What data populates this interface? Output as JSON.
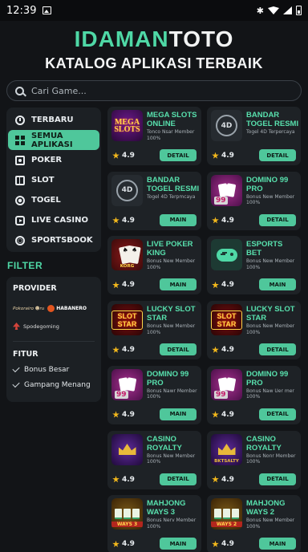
{
  "status_bar": {
    "time": "12:39"
  },
  "brand": {
    "part1": "IDAMAN",
    "part2": "TOTO"
  },
  "subtitle": "KATALOG APLIKASI TERBAIK",
  "search": {
    "placeholder": "Cari Game..."
  },
  "sidebar": {
    "items": [
      {
        "label": "TERBARU",
        "icon": "clock-icon",
        "active": false
      },
      {
        "label": "SEMUA APLIKASI",
        "icon": "grid-icon",
        "active": true
      },
      {
        "label": "POKER",
        "icon": "cards-icon",
        "active": false
      },
      {
        "label": "SLOT",
        "icon": "slot-icon",
        "active": false
      },
      {
        "label": "TOGEL",
        "icon": "lottery-ball-icon",
        "active": false
      },
      {
        "label": "LIVE CASINO",
        "icon": "live-icon",
        "active": false
      },
      {
        "label": "SPORTSBOOK",
        "icon": "sports-ball-icon",
        "active": false
      }
    ]
  },
  "filter": {
    "title": "FILTER",
    "provider_heading": "PROVIDER",
    "providers": [
      "Pokorairo ☻ru",
      "HABANERO",
      "Spodegoming"
    ],
    "features_heading": "FITUR",
    "features": [
      "Bonus Besar",
      "Gampang Menang"
    ]
  },
  "cards": [
    {
      "title": "MEGA SLOTS ONLINE",
      "desc": "Tonco Nsar Member 100%",
      "rating": "4.9",
      "button": "DETAIL",
      "thumb": "mega",
      "thumb_text": "MEGA SLOTS"
    },
    {
      "title": "BANDAR TOGEL RESMI",
      "desc": "Togel 4D Terpercaya",
      "rating": "4.9",
      "button": "DETAIL",
      "thumb": "4d",
      "thumb_text": "4D"
    },
    {
      "title": "BANDAR TOGEL RESMI",
      "desc": "Togel 4D Terpmcaya",
      "rating": "4.9",
      "button": "MAIN",
      "thumb": "4d",
      "thumb_text": "4D"
    },
    {
      "title": "DOMINO 99 PRO",
      "desc": "Bonus New Member 100%",
      "rating": "4.9",
      "button": "DETAIL",
      "thumb": "domino",
      "thumb_text": "99"
    },
    {
      "title": "LIVE POKER KING",
      "desc": "Bonus New Member 100%",
      "rating": "4.9",
      "button": "MAIN",
      "thumb": "poker",
      "thumb_text": "KORG"
    },
    {
      "title": "ESPORTS BET",
      "desc": "Bonus New Member 100%",
      "rating": "4.9",
      "button": "MAIN",
      "thumb": "esports",
      "thumb_text": ""
    },
    {
      "title": "LUCKY SLOT STAR",
      "desc": "Bonus New Member 100%",
      "rating": "4.9",
      "button": "DETAIL",
      "thumb": "slot",
      "thumb_text": "SLOT STAR"
    },
    {
      "title": "LUCKY SLOT STAR",
      "desc": "Bonus New Member 100%",
      "rating": "4.9",
      "button": "DETAIL",
      "thumb": "slot",
      "thumb_text": "SLOT STAR"
    },
    {
      "title": "DOMINO 99 PRO",
      "desc": "Bonus Nawr Member 100%",
      "rating": "4.9",
      "button": "MAIN",
      "thumb": "domino",
      "thumb_text": "99"
    },
    {
      "title": "DOMINO 99 PRO",
      "desc": "Bonus Naw Uer mer 100%",
      "rating": "4.9",
      "button": "DETAIL",
      "thumb": "domino",
      "thumb_text": "99"
    },
    {
      "title": "CASINO ROYALTY",
      "desc": "Bonus New Member 100%",
      "rating": "4.9",
      "button": "DETAIL",
      "thumb": "royal",
      "thumb_text": ""
    },
    {
      "title": "CASINO ROYALTY",
      "desc": "Bonus Nonr Member 100%",
      "rating": "4.9",
      "button": "DETAIL",
      "thumb": "royal",
      "thumb_text": "BKTSALTY"
    },
    {
      "title": "MAHJONG WAYS 3",
      "desc": "Bonus Nerv Member 100%",
      "rating": "4.9",
      "button": "MAIN",
      "thumb": "mahjong",
      "thumb_text": "WAYS 3"
    },
    {
      "title": "MAHJONG WAYS 2",
      "desc": "Bonus New Member 100%",
      "rating": "4.9",
      "button": "MAIN",
      "thumb": "mahjong",
      "thumb_text": "WAYS 2"
    }
  ]
}
